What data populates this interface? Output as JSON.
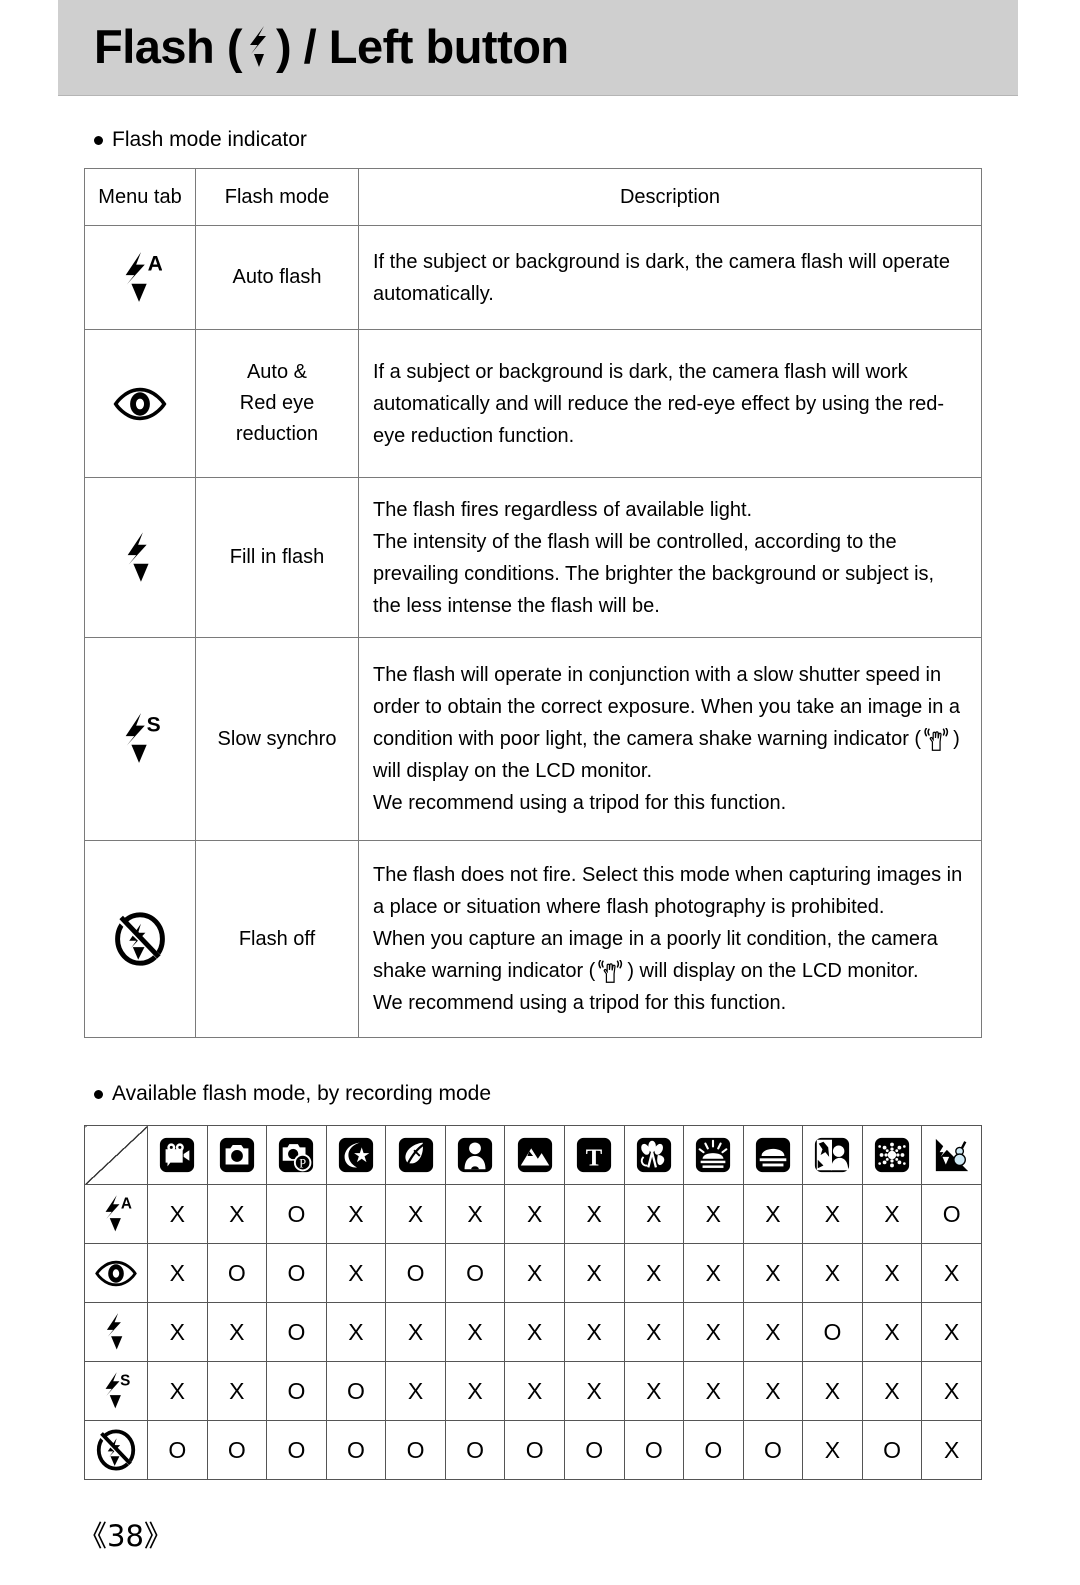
{
  "header": {
    "title_before": "Flash (",
    "icon": "flash-bolt-icon",
    "title_after": ") / Left button"
  },
  "section1": {
    "bullet": "Flash mode indicator",
    "columns": [
      "Menu tab",
      "Flash mode",
      "Description"
    ],
    "rows": [
      {
        "icon": "flash-auto-icon",
        "mode": "Auto flash",
        "description": "If the subject or background is dark, the camera flash will operate automatically."
      },
      {
        "icon": "red-eye-reduction-icon",
        "mode": "Auto &\nRed eye\nreduction",
        "description": "If a subject or background is dark, the camera flash will work automatically and will reduce the red-eye effect by using the red-eye reduction function."
      },
      {
        "icon": "fill-in-flash-icon",
        "mode": "Fill in flash",
        "description": "The flash fires regardless of available light.\nThe intensity of the flash will be controlled, according to the prevailing conditions. The brighter the background or subject is, the less intense the flash will be."
      },
      {
        "icon": "slow-synchro-icon",
        "mode": "Slow synchro",
        "description_part1": "The flash will operate in conjunction with a slow shutter speed in order to obtain the correct exposure. When you take an image in a condition with poor light, the camera shake warning indicator (",
        "description_part2": ") will display on the LCD monitor.",
        "description_part3": "We recommend using a tripod for this function.",
        "inline_icon": "camera-shake-warning-icon"
      },
      {
        "icon": "flash-off-icon",
        "mode": "Flash off",
        "description_part1": "The flash does not fire. Select this mode when capturing images in a place or situation where flash photography is prohibited.",
        "description_part2": "When you capture an image in a poorly lit condition, the camera shake warning indicator (",
        "description_part3": ") will display on the LCD monitor.",
        "description_part4": "We recommend using a tripod for this function.",
        "inline_icon": "camera-shake-warning-icon"
      }
    ]
  },
  "section2": {
    "bullet": "Available flash mode, by recording mode",
    "mode_icons": [
      "movie-clip-mode-icon",
      "auto-mode-icon",
      "program-mode-icon",
      "night-scene-mode-icon",
      "sports-mode-icon",
      "portrait-mode-icon",
      "landscape-mode-icon",
      "text-mode-icon",
      "close-up-mode-icon",
      "sunrise-mode-icon",
      "sunset-mode-icon",
      "backlight-mode-icon",
      "fireworks-mode-icon",
      "beach-snow-mode-icon"
    ],
    "flash_icons": [
      "flash-auto-icon",
      "red-eye-reduction-icon",
      "fill-in-flash-icon",
      "slow-synchro-icon",
      "flash-off-icon"
    ],
    "matrix": [
      [
        "X",
        "X",
        "O",
        "X",
        "X",
        "X",
        "X",
        "X",
        "X",
        "X",
        "X",
        "X",
        "X",
        "O"
      ],
      [
        "X",
        "O",
        "O",
        "X",
        "O",
        "O",
        "X",
        "X",
        "X",
        "X",
        "X",
        "X",
        "X",
        "X"
      ],
      [
        "X",
        "X",
        "O",
        "X",
        "X",
        "X",
        "X",
        "X",
        "X",
        "X",
        "X",
        "O",
        "X",
        "X"
      ],
      [
        "X",
        "X",
        "O",
        "O",
        "X",
        "X",
        "X",
        "X",
        "X",
        "X",
        "X",
        "X",
        "X",
        "X"
      ],
      [
        "O",
        "O",
        "O",
        "O",
        "O",
        "O",
        "O",
        "O",
        "O",
        "O",
        "O",
        "X",
        "O",
        "X"
      ]
    ]
  },
  "footer": {
    "page": "《38》"
  },
  "colors": {
    "header_band": "#cfcfcf",
    "table_border": "#7a7a7a",
    "text": "#000000",
    "page_bg": "#ffffff"
  }
}
